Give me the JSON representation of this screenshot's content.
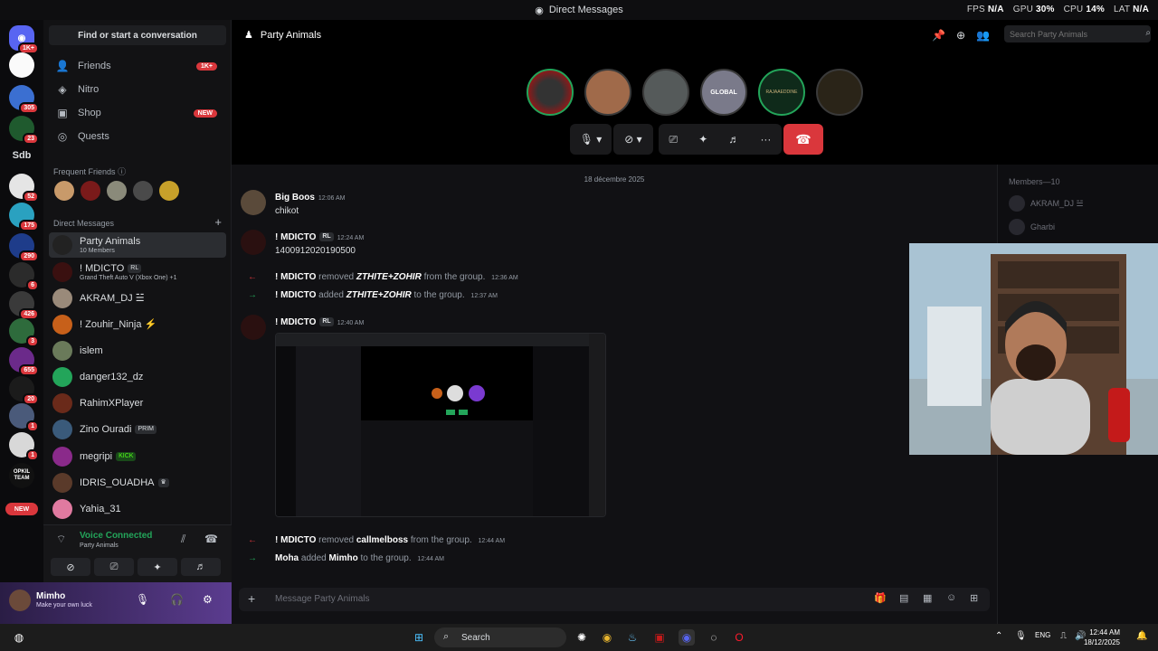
{
  "window": {
    "title": "Direct Messages",
    "hud": [
      {
        "k": "FPS",
        "v": "N/A"
      },
      {
        "k": "GPU",
        "v": "30%"
      },
      {
        "k": "CPU",
        "v": "14%"
      },
      {
        "k": "LAT",
        "v": "N/A"
      }
    ]
  },
  "rail": {
    "badges": [
      "1K+",
      "305",
      "23",
      "52",
      "175",
      "290",
      "6",
      "426",
      "3",
      "655",
      "20",
      "1",
      "1"
    ],
    "text_server": "Sdb",
    "bottom_label": "OPKIL TEAM",
    "new_label": "NEW"
  },
  "sidebar": {
    "find_label": "Find or start a conversation",
    "nav": [
      {
        "label": "Friends",
        "badge": "1K+",
        "icon": "friends-icon"
      },
      {
        "label": "Nitro",
        "badge": "",
        "icon": "nitro-icon"
      },
      {
        "label": "Shop",
        "badge": "NEW",
        "icon": "shop-icon"
      },
      {
        "label": "Quests",
        "badge": "",
        "icon": "quests-icon"
      }
    ],
    "frequent_title": "Frequent Friends",
    "dm_title": "Direct Messages",
    "dms": [
      {
        "name": "Party Animals",
        "sub": "10 Members",
        "tag": ""
      },
      {
        "name": "! MDICTO",
        "sub": "Grand Theft Auto V (Xbox One) +1",
        "tag": "RL"
      },
      {
        "name": "AKRAM_DJ ☱",
        "sub": "",
        "tag": ""
      },
      {
        "name": "! Zouhir_Ninja ⚡",
        "sub": "",
        "tag": ""
      },
      {
        "name": "islem",
        "sub": "",
        "tag": ""
      },
      {
        "name": "danger132_dz",
        "sub": "",
        "tag": ""
      },
      {
        "name": "RahimXPlayer",
        "sub": "",
        "tag": ""
      },
      {
        "name": "Zino Ouradi",
        "sub": "",
        "tag": "PRIM"
      },
      {
        "name": "megripi",
        "sub": "",
        "tag": "KICK"
      },
      {
        "name": "IDRIS_OUADHA",
        "sub": "",
        "tag": "♛"
      },
      {
        "name": "Yahia_31",
        "sub": "",
        "tag": ""
      }
    ],
    "voice": {
      "title": "Voice Connected",
      "sub": "Party Animals"
    },
    "user": {
      "name": "Mimho",
      "status": "Make your own luck"
    }
  },
  "call": {
    "channel": "Party Animals",
    "search_placeholder": "Search Party Animals",
    "avatar_labels": [
      "",
      "",
      "",
      "GLOBAL",
      "RAJAAEDDINE",
      ""
    ]
  },
  "chat": {
    "date": "18 décembre 2025",
    "messages": [
      {
        "author": "Big Boos",
        "time": "12:06 AM",
        "text": "chikot"
      },
      {
        "author": "! MDICTO",
        "tag": "RL",
        "time": "12:24 AM",
        "text": "1400912020190500"
      },
      {
        "author": "! MDICTO",
        "tag": "RL",
        "time": "12:40 AM",
        "text": ""
      }
    ],
    "system": [
      {
        "actor": "! MDICTO",
        "verb": "removed",
        "target": "ZTHITE+ZOHIR",
        "rest": "from the group.",
        "time": "12:36 AM"
      },
      {
        "actor": "! MDICTO",
        "verb": "added",
        "target": "ZTHITE+ZOHIR",
        "rest": "to the group.",
        "time": "12:37 AM"
      },
      {
        "actor": "! MDICTO",
        "verb": "removed",
        "target": "callmelboss",
        "rest": "from the group.",
        "time": "12:44 AM"
      },
      {
        "actor": "Moha",
        "verb": "added",
        "target": "Mimho",
        "rest": "to the group.",
        "time": "12:44 AM"
      }
    ],
    "composer_placeholder": "Message Party Animals"
  },
  "members": {
    "header": "Members—10",
    "list": [
      "AKRAM_DJ ☱",
      "Gharbi"
    ]
  },
  "taskbar": {
    "search": "Search",
    "lang": "ENG",
    "time": "12:44 AM",
    "date": "18/12/2025"
  }
}
